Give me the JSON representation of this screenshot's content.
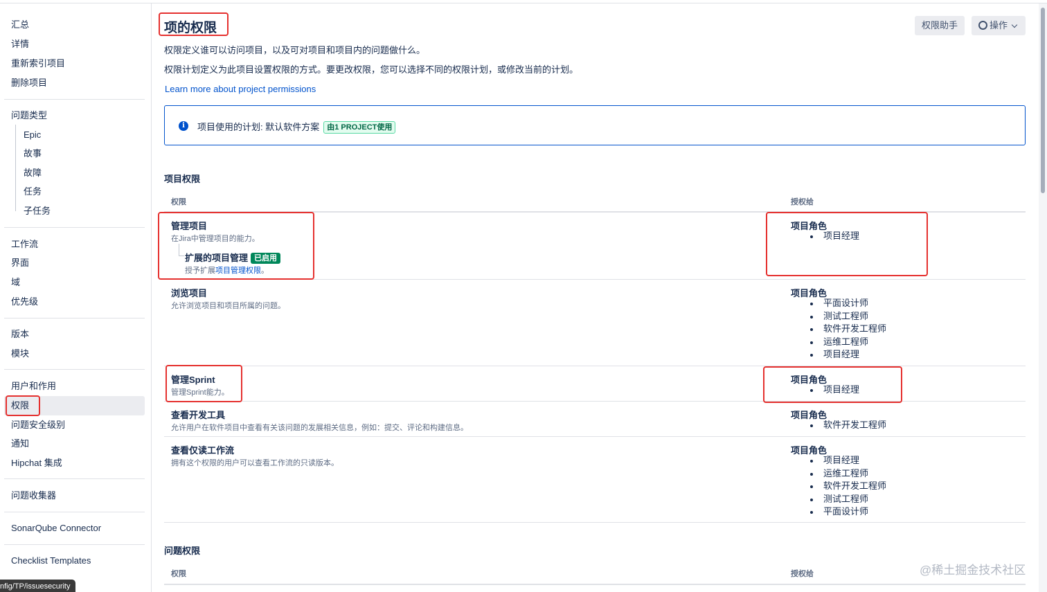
{
  "sidebar": {
    "items": [
      {
        "label": "汇总"
      },
      {
        "label": "详情"
      },
      {
        "label": "重新索引项目"
      },
      {
        "label": "删除项目"
      },
      {
        "label": "问题类型"
      },
      {
        "label": "Epic"
      },
      {
        "label": "故事"
      },
      {
        "label": "故障"
      },
      {
        "label": "任务"
      },
      {
        "label": "子任务"
      },
      {
        "label": "工作流"
      },
      {
        "label": "界面"
      },
      {
        "label": "域"
      },
      {
        "label": "优先级"
      },
      {
        "label": "版本"
      },
      {
        "label": "模块"
      },
      {
        "label": "用户和作用"
      },
      {
        "label": "权限"
      },
      {
        "label": "问题安全级别"
      },
      {
        "label": "通知"
      },
      {
        "label": "Hipchat 集成"
      },
      {
        "label": "问题收集器"
      },
      {
        "label": "SonarQube Connector"
      },
      {
        "label": "Checklist Templates"
      }
    ],
    "active": "权限",
    "status_url": "nfig/TP/issuesecurity"
  },
  "header": {
    "title": "项的权限",
    "desc1": "权限定义谁可以访问项目，以及可对项目和项目内的问题做什么。",
    "desc2": "权限计划定义为此项目设置权限的方式。要更改权限，您可以选择不同的权限计划，或修改当前的计划。",
    "learn_more": "Learn more about project permissions",
    "helper_button": "权限助手",
    "actions_button": "操作"
  },
  "scheme": {
    "label": "项目使用的计划: 默认软件方案",
    "badge": "由1 PROJECT使用"
  },
  "project_permissions": {
    "section_title": "项目权限",
    "col_permission": "权限",
    "col_granted": "授权给",
    "rows": [
      {
        "name": "管理项目",
        "desc": "在Jira中管理项目的能力。",
        "grant_title": "项目角色",
        "grants": [
          "项目经理"
        ],
        "extension": {
          "name": "扩展的项目管理",
          "badge": "已启用",
          "desc_prefix": "授予扩展",
          "desc_link": "项目管理权限",
          "desc_suffix": "。"
        }
      },
      {
        "name": "浏览项目",
        "desc": "允许浏览项目和项目所属的问题。",
        "grant_title": "项目角色",
        "grants": [
          "平面设计师",
          "测试工程师",
          "软件开发工程师",
          "运维工程师",
          "项目经理"
        ]
      },
      {
        "name": "管理Sprint",
        "desc": "管理Sprint能力。",
        "grant_title": "项目角色",
        "grants": [
          "项目经理"
        ]
      },
      {
        "name": "查看开发工具",
        "desc": "允许用户在软件项目中查看有关该问题的发展相关信息，例如：提交、评论和构建信息。",
        "grant_title": "项目角色",
        "grants": [
          "软件开发工程师"
        ]
      },
      {
        "name": "查看仅读工作流",
        "desc": "拥有这个权限的用户可以查看工作流的只读版本。",
        "grant_title": "项目角色",
        "grants": [
          "项目经理",
          "运维工程师",
          "软件开发工程师",
          "测试工程师",
          "平面设计师"
        ]
      }
    ]
  },
  "issue_permissions": {
    "section_title": "问题权限",
    "col_permission": "权限",
    "col_granted": "授权给"
  },
  "watermark": "@稀土掘金技术社区",
  "colors": {
    "link": "#0052cc",
    "annotation_red": "#e5302e",
    "enabled_green": "#00875a"
  },
  "icons": {
    "info": "info-icon",
    "gear": "gear-icon",
    "chevron": "chevron-down-icon"
  }
}
